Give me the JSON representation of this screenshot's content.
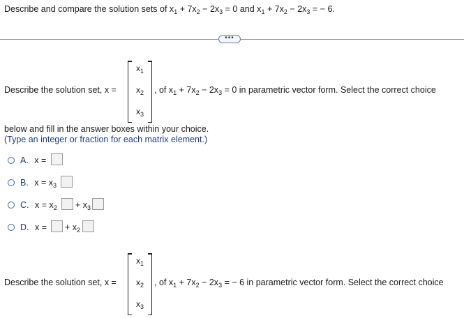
{
  "question": {
    "prefix": "Describe and compare the solution sets of x",
    "eq1_rest": "+ 7x",
    "eq1_rest2": "− 2x",
    "eq1_rhs": "= 0 and x",
    "eq2_rest": "+ 7x",
    "eq2_rest2": "− 2x",
    "eq2_rhs": "= − 6."
  },
  "expand_button": "•••",
  "part1": {
    "lead": "Describe the solution set, x =",
    "vector": [
      "x1",
      "x2",
      "x3"
    ],
    "tail_a": ", of x",
    "tail_b": "+ 7x",
    "tail_c": "− 2x",
    "tail_d": "= 0 in parametric vector form. Select the correct choice",
    "line2": "below and fill in the answer boxes within your choice.",
    "line3": "(Type an integer or fraction for each matrix element.)"
  },
  "options": [
    {
      "letter": "A.",
      "expr": "x ="
    },
    {
      "letter": "B.",
      "expr": "x = x"
    },
    {
      "letter": "C.",
      "expr": "x = x",
      "plus": "+ x"
    },
    {
      "letter": "D.",
      "expr": "x =",
      "plus": "+ x"
    }
  ],
  "part2": {
    "lead": "Describe the solution set, x =",
    "tail_a": ", of x",
    "tail_b": "+ 7x",
    "tail_c": "− 2x",
    "tail_d": "= − 6 in parametric vector form. Select the correct choice"
  },
  "subscripts": {
    "one": "1",
    "two": "2",
    "three": "3"
  }
}
